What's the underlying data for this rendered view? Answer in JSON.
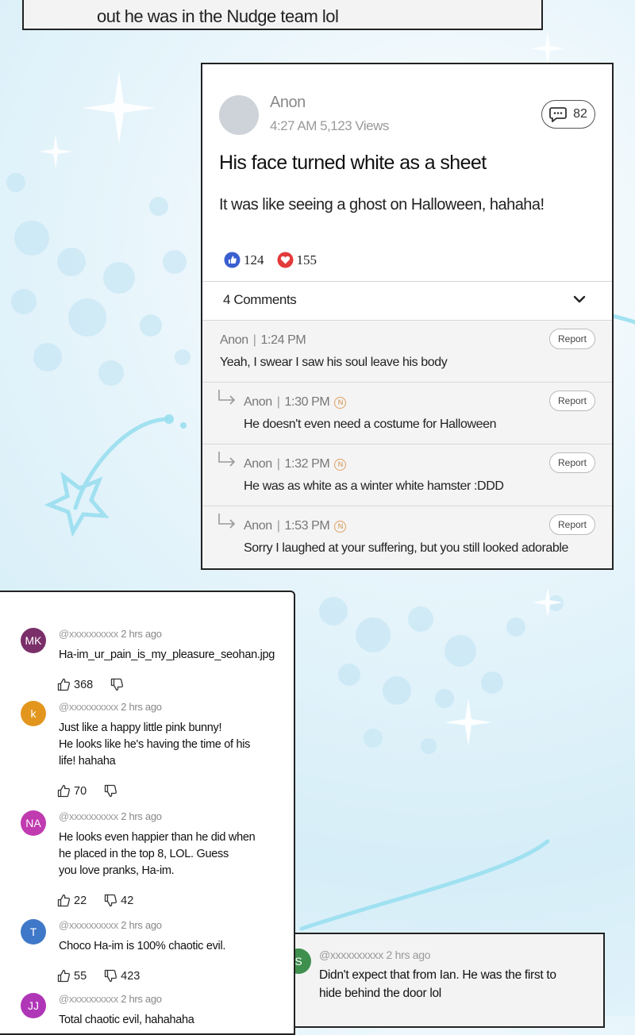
{
  "top_panel": {
    "text": "out he was in the Nudge team lol"
  },
  "post": {
    "author": "Anon",
    "meta": "4:27 AM 5,123 Views",
    "comment_count": "82",
    "title": "His face turned white as a sheet",
    "body": "It was like seeing a ghost on Halloween, hahaha!",
    "likes": "124",
    "hearts": "155",
    "comments_label": "4 Comments",
    "comments": [
      {
        "author": "Anon",
        "sep": "|",
        "time": "1:24 PM",
        "text": "Yeah, I swear I saw his soul leave his body",
        "report": "Report",
        "reply": false,
        "badge": ""
      },
      {
        "author": "Anon",
        "sep": "|",
        "time": "1:30 PM",
        "text": "He doesn't even need a costume for Halloween",
        "report": "Report",
        "reply": true,
        "badge": "N"
      },
      {
        "author": "Anon",
        "sep": "|",
        "time": "1:32 PM",
        "text": "He was as white as a winter white hamster :DDD",
        "report": "Report",
        "reply": true,
        "badge": "N"
      },
      {
        "author": "Anon",
        "sep": "|",
        "time": "1:53 PM",
        "text": "Sorry I laughed at your suffering, but you still looked adorable",
        "report": "Report",
        "reply": true,
        "badge": "N"
      }
    ]
  },
  "reader_comments": [
    {
      "initials": "MK",
      "color": "#7a2f6a",
      "handle": "@xxxxxxxxxx",
      "time": "2 hrs ago",
      "lines": [
        "Ha-im_ur_pain_is_my_pleasure_seohan.jpg"
      ],
      "up": "368",
      "down": ""
    },
    {
      "initials": "k",
      "color": "#e3961e",
      "handle": "@xxxxxxxxxx",
      "time": "2 hrs ago",
      "lines": [
        "Just like a happy little pink bunny!",
        "He looks like he's having the time of his",
        "life! hahaha"
      ],
      "up": "70",
      "down": ""
    },
    {
      "initials": "NA",
      "color": "#c03ab0",
      "handle": "@xxxxxxxxxx",
      "time": "2 hrs ago",
      "lines": [
        "He looks even happier than he did when",
        "he placed in the top 8, LOL. Guess",
        "you love pranks, Ha-im."
      ],
      "up": "22",
      "down": "42"
    },
    {
      "initials": "T",
      "color": "#3f78c8",
      "handle": "@xxxxxxxxxx",
      "time": "2 hrs ago",
      "lines": [
        "Choco Ha-im is 100% chaotic evil."
      ],
      "up": "55",
      "down": "423"
    },
    {
      "initials": "JJ",
      "color": "#b036b8",
      "handle": "@xxxxxxxxxx",
      "time": "2 hrs ago",
      "lines": [
        "Total chaotic evil, hahahaha"
      ],
      "up": "",
      "down": ""
    }
  ],
  "right_comment": {
    "initials": "S",
    "handle": "@xxxxxxxxxx",
    "time": "2 hrs ago",
    "lines": [
      "Didn't expect that from Ian. He was the first to",
      "hide behind the door lol"
    ]
  }
}
